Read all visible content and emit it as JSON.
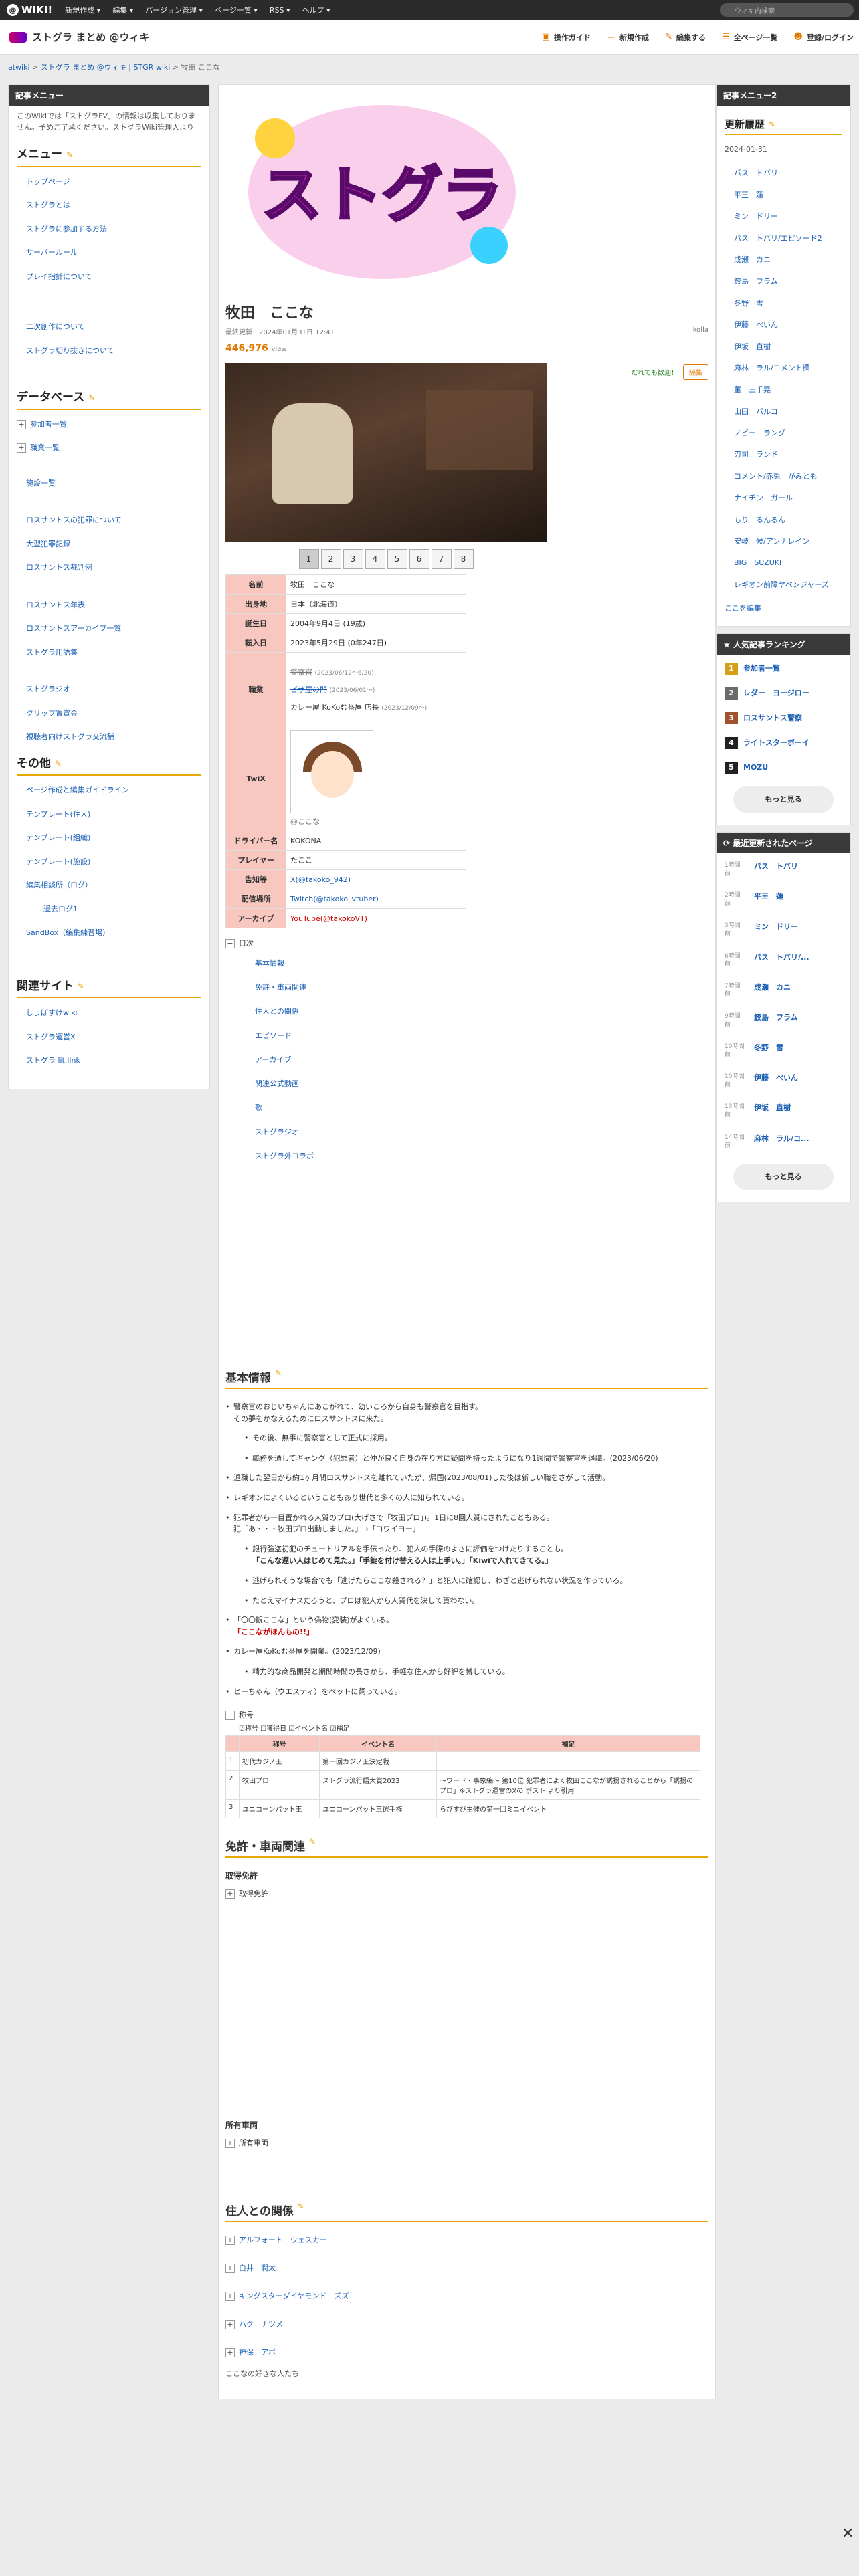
{
  "topbar": {
    "logo": "WIKI!",
    "menu": [
      "新規作成 ▾",
      "編集 ▾",
      "バージョン管理 ▾",
      "ページ一覧 ▾",
      "RSS ▾",
      "ヘルプ ▾"
    ],
    "search_placeholder": "ウィキ内検索"
  },
  "header": {
    "site_title": "ストグラ まとめ @ウィキ",
    "actions": [
      "操作ガイド",
      "新規作成",
      "編集する",
      "全ページ一覧",
      "登録/ログイン"
    ]
  },
  "breadcrumb": {
    "items": [
      "atwiki",
      "ストグラ まとめ @ウィキ | STGR wiki",
      "牧田 ここな"
    ]
  },
  "left": {
    "box_title": "記事メニュー",
    "note": "このWikiでは「ストグラFV」の情報は収集しておりません。予めご了承ください。ストグラWiki管理人より",
    "menu_title": "メニュー",
    "menu1": [
      "トップページ",
      "ストグラとは",
      "ストグラに参加する方法",
      "サーバールール",
      "プレイ指針について"
    ],
    "menu2": [
      "二次創作について",
      "ストグラ切り抜きについて"
    ],
    "db_title": "データベース",
    "db_plus": [
      "参加者一覧",
      "職業一覧"
    ],
    "db_links": [
      "施設一覧",
      "ロスサントスの犯罪について",
      "大型犯罪記録",
      "ロスサントス裁判例",
      "ロスサントス年表",
      "ロスサントスアーカイブ一覧",
      "ストグラ用語集",
      "ストグラジオ",
      "クリップ置賞会",
      "視聴者向けストグラ交流舗"
    ],
    "other_title": "その他",
    "other": [
      "ページ作成と編集ガイドライン",
      "テンプレート(住人)",
      "テンプレート(組織)",
      "テンプレート(施設)",
      "編集相談所（ログ）",
      "過去ログ1",
      "SandBox（編集練習場）"
    ],
    "related_title": "関連サイト",
    "related": [
      "しょぼすけwiki",
      "ストグラ運営X",
      "ストグラ lit.link"
    ]
  },
  "article": {
    "banner_text": "ストグラ",
    "title": "牧田　ここな",
    "updated": "最終更新：2024年01月31日 12:41",
    "author": "kolla",
    "views": "446,976",
    "views_unit": "view",
    "welcome": "だれでも歓迎！",
    "edit": "編集",
    "pages": [
      "1",
      "2",
      "3",
      "4",
      "5",
      "6",
      "7",
      "8"
    ],
    "info": [
      {
        "k": "名前",
        "v": "牧田　ここな"
      },
      {
        "k": "出身地",
        "v": "日本（北海道）"
      },
      {
        "k": "誕生日",
        "v": "2004年9月4日 (19歳)"
      },
      {
        "k": "転入日",
        "v": "2023年5月29日 (0年247日)"
      }
    ],
    "job_k": "職業",
    "job1": "警察官",
    "job1d": "(2023/06/12〜6/20)",
    "job2": "ピザ屋の門",
    "job2d": "(2023/06/01〜)",
    "job3": "カレー屋 KoKoむ番屋 店長",
    "job3d": "(2023/12/09〜)",
    "twix_k": "TwiX",
    "twix_v": "@ここな",
    "info2": [
      {
        "k": "ドライバー名",
        "v": "KOKONA"
      },
      {
        "k": "プレイヤー",
        "v": "たここ"
      },
      {
        "k": "告知等",
        "v": "X(@takoko_942)"
      },
      {
        "k": "配信場所",
        "v": "Twitch(@takoko_vtuber)"
      },
      {
        "k": "アーカイブ",
        "v": "YouTube(@takokoVT)"
      }
    ],
    "toc_title": "目次",
    "toc": [
      "基本情報",
      "免許・車両関連",
      "住人との関係",
      "エピソード",
      "アーカイブ",
      "関連公式動画",
      "歌",
      "ストグラジオ",
      "ストグラ外コラボ"
    ],
    "basic_title": "基本情報",
    "b1": "警察官のおじいちゃんにあこがれて、幼いころから自身も警察官を目指す。",
    "b1b": "その夢をかなえるためにロスサントスに来た。",
    "b1s1": "その後、無事に警察官として正式に採用。",
    "b1s2": "職務を通してギャング（犯罪者）と仲が良く自身の在り方に疑問を持ったようになり1週間で警察官を退職。(2023/06/20)",
    "b2": "退職した翌日から約1ヶ月間ロスサントスを離れていたが、帰国(2023/08/01)した後は新しい職をさがして活動。",
    "b3": "レギオンによくいるということもあり世代と多くの人に知られている。",
    "b4": "犯罪者から一目置かれる人質のプロ(大げさで「牧田プロ」)。1日に8回人質にされたこともある。",
    "b4b": "犯「あ・・・牧田プロ出動しました。」→「コワイヨー」",
    "b4s1": "銀行強盗初犯のチュートリアルを手伝ったり、犯人の手際のよさに評価をつけたりすることも。",
    "b4s1b": "「こんな遅い人はじめて見た。」「手錠を付け替える人は上手い。」「Kiwiで入れてきてる。」",
    "b4s2": "逃げられそうな場合でも「逃げたらここな殺される？」と犯人に確認し、わざと逃げられない状況を作っている。",
    "b4s3": "たとえマイナスだろうと、プロは犯人から人質代を決して貰わない。",
    "b5": "「〇〇観ここな」という偽物(変装)がよくいる。",
    "b5b": "「ここながほんもの!!」",
    "b6": "カレー屋KoKoむ番屋を開業。(2023/12/09)",
    "b6s": "精力的な商品開発と期間時間の長さから、手軽な住人から好評を博している。",
    "b7": "ヒーちゃん（ウエスティ）をペットに飼っている。",
    "title_fold": "称号",
    "filters": [
      "称号",
      "獲得日",
      "イベント名",
      "補足"
    ],
    "tt_head": [
      "称号",
      "イベント名",
      "補足"
    ],
    "tt_rows": [
      {
        "n": "1",
        "a": "初代カジノ王",
        "b": "第一回カジノ王決定戦",
        "c": ""
      },
      {
        "n": "2",
        "a": "牧田プロ",
        "b": "ストグラ流行語大賞2023",
        "c": "〜ワード・事象編〜 第10位 犯罪者によく牧田ここなが誘拐されることから「誘拐のプロ」※ストグラ運営のXの ポスト より引用"
      },
      {
        "n": "3",
        "a": "ユニコーンパット王",
        "b": "ユニコーンパット王選手権",
        "c": "らびすび主催の第一回ミニイベント"
      }
    ],
    "license_title": "免許・車両関連",
    "lic_sub": "取得免許",
    "lic_fold": "取得免許",
    "car_sub": "所有車両",
    "car_fold": "所有車両",
    "rel_title": "住人との関係",
    "rel": [
      "アルフォート　ウェスカー",
      "白井　潤太",
      "キングスターダイヤモンド　ズズ",
      "ハク　ナツメ",
      "神保　アポ"
    ],
    "rel_note": "ここなの好きな人たち"
  },
  "right": {
    "box_title": "記事メニュー2",
    "hist_title": "更新履歴",
    "hist_date": "2024-01-31",
    "hist": [
      "パス　トバリ",
      "平王　蓮",
      "ミン　ドリー",
      "パス　トバリ/エピソード2",
      "成瀬　カニ",
      "鮫島　フラム",
      "冬野　雪",
      "伊藤　ぺいん",
      "伊坂　直樹",
      "麻林　ラル/コメント欄",
      "菫　三千晃",
      "山田　パルコ",
      "ノビー　ラング",
      "刃司　ランド",
      "コメント/赤兎　がみとも",
      "ナイチン　ガール",
      "もり　るんるん",
      "安岐　候/アンナレイン",
      "BIG　SUZUKI",
      "レギオン前障ヤベンジャーズ"
    ],
    "edit_here": "ここを編集",
    "rank_title": "人気記事ランキング",
    "ranks": [
      {
        "n": "1",
        "t": "参加者一覧",
        "c": "#d4a017"
      },
      {
        "n": "2",
        "t": "レダー　ヨージロー",
        "c": "#6b6b6b"
      },
      {
        "n": "3",
        "t": "ロスサントス警察",
        "c": "#a0522d"
      },
      {
        "n": "4",
        "t": "ライトスターボーイ",
        "c": "#222222"
      },
      {
        "n": "5",
        "t": "MOZU",
        "c": "#222222"
      }
    ],
    "more": "もっと見る",
    "upd_title": "最近更新されたページ",
    "upd": [
      {
        "d": "1時間前",
        "n": "パス　トバリ"
      },
      {
        "d": "2時間前",
        "n": "平王　蓮"
      },
      {
        "d": "3時間前",
        "n": "ミン　ドリー"
      },
      {
        "d": "6時間前",
        "n": "パス　トバリ/..."
      },
      {
        "d": "7時間前",
        "n": "成瀬　カニ"
      },
      {
        "d": "9時間前",
        "n": "鮫島　フラム"
      },
      {
        "d": "10時間前",
        "n": "冬野　雪"
      },
      {
        "d": "10時間前",
        "n": "伊藤　ぺいん"
      },
      {
        "d": "13時間前",
        "n": "伊坂　直樹"
      },
      {
        "d": "14時間前",
        "n": "麻林　ラル/コ..."
      }
    ],
    "more2": "もっと見る"
  }
}
